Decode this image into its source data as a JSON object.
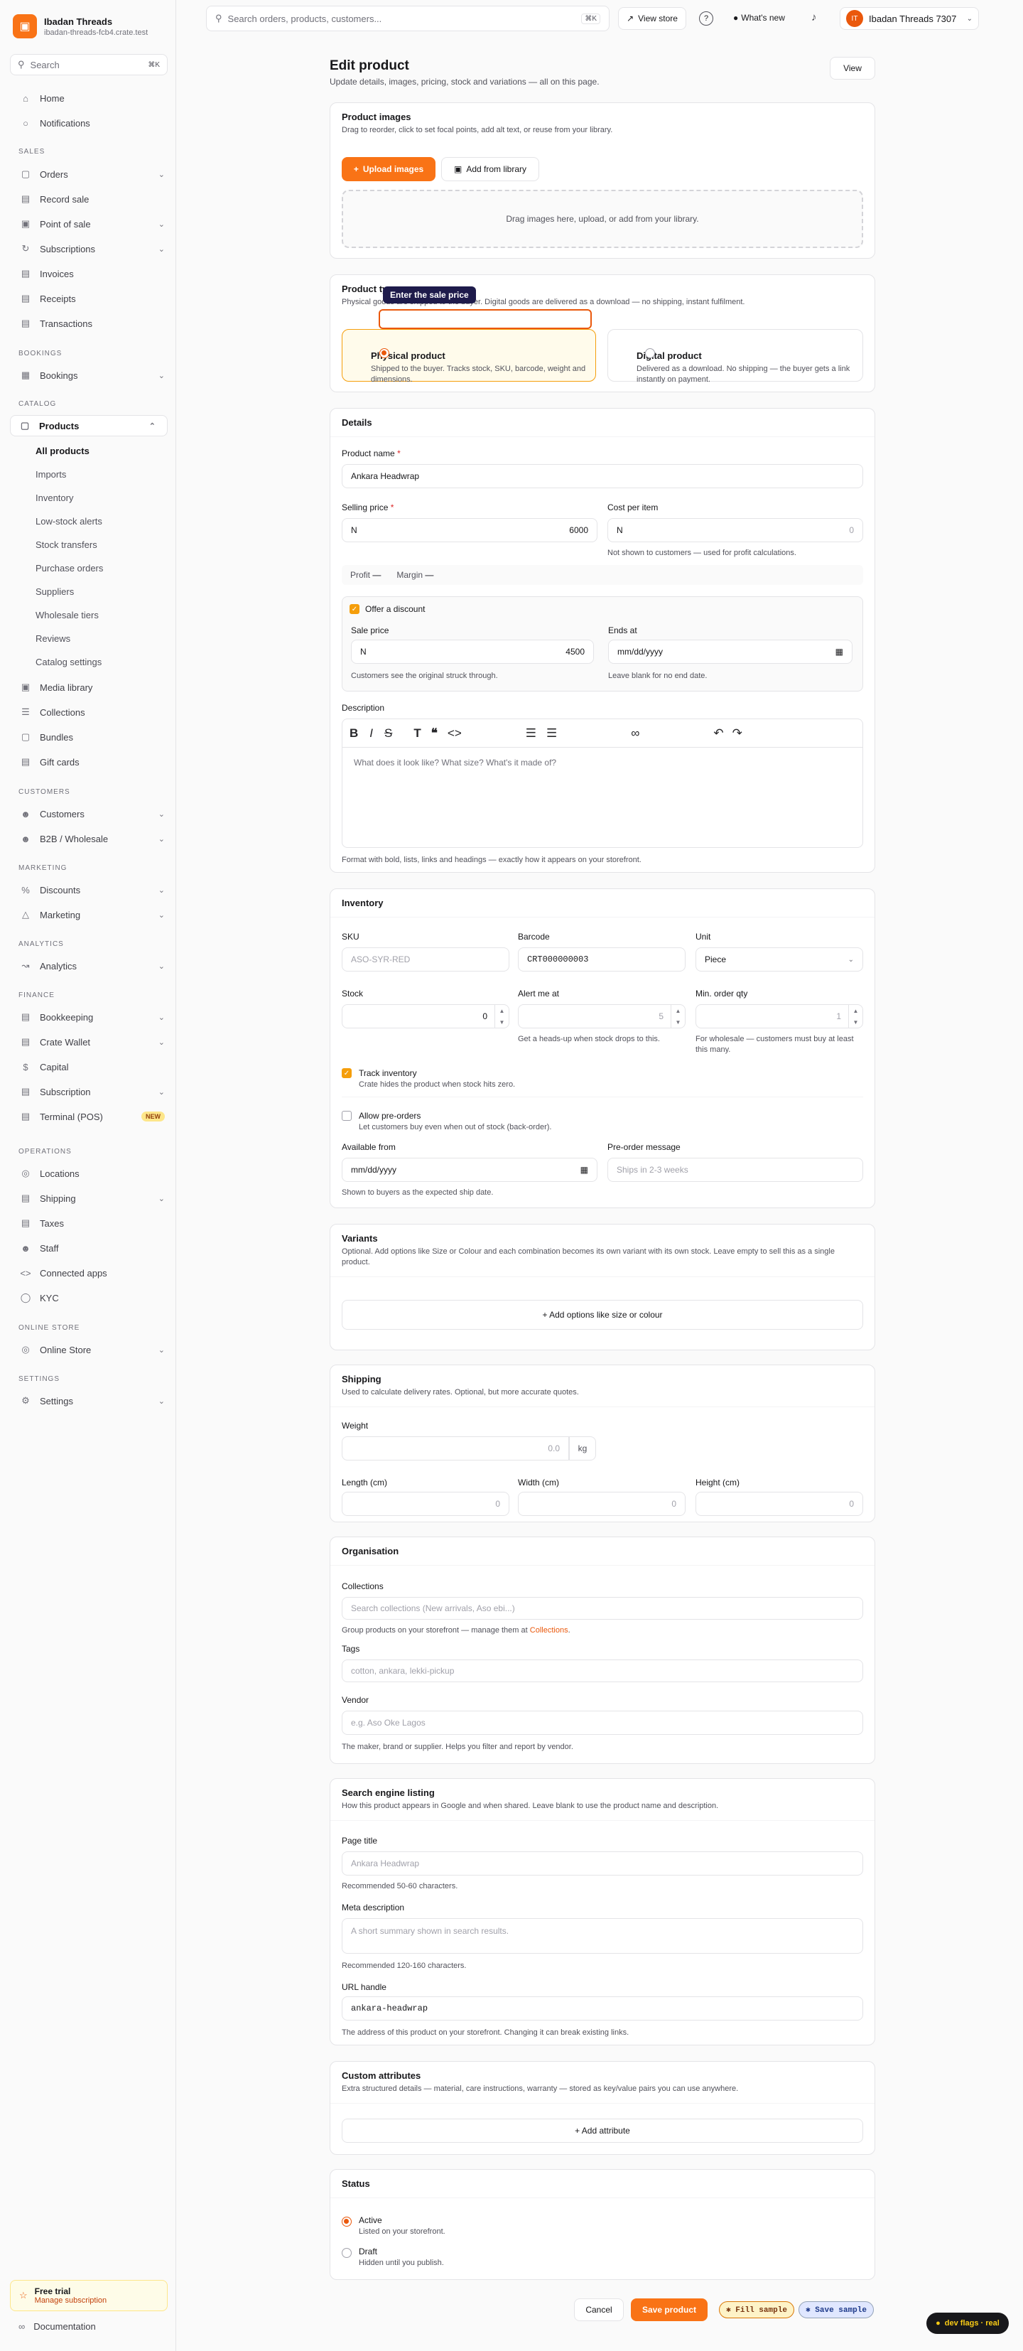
{
  "store": {
    "name": "Ibadan Threads",
    "domain": "ibadan-threads-fcb4.crate.test"
  },
  "sidebar": {
    "search_placeholder": "Search",
    "search_kbd": "⌘K",
    "top_items": [
      "Home",
      "Notifications"
    ],
    "sections": {
      "sales": "SALES",
      "bookings": "BOOKINGS",
      "catalog": "CATALOG",
      "customers": "CUSTOMERS",
      "marketing": "MARKETING",
      "analytics": "ANALYTICS",
      "finance": "FINANCE",
      "operations": "OPERATIONS",
      "online_store": "ONLINE STORE",
      "settings": "SETTINGS"
    },
    "sales_items": [
      "Orders",
      "Record sale",
      "Point of sale",
      "Subscriptions",
      "Invoices",
      "Receipts",
      "Transactions"
    ],
    "bookings_items": [
      "Bookings"
    ],
    "catalog_items": [
      "Products"
    ],
    "products_sub": [
      "All products",
      "Imports",
      "Inventory",
      "Low-stock alerts",
      "Stock transfers",
      "Purchase orders",
      "Suppliers",
      "Wholesale tiers",
      "Reviews",
      "Catalog settings"
    ],
    "catalog_more": [
      "Media library",
      "Collections",
      "Bundles",
      "Gift cards"
    ],
    "customers_items": [
      "Customers",
      "B2B / Wholesale"
    ],
    "marketing_items": [
      "Discounts",
      "Marketing"
    ],
    "analytics_items": [
      "Analytics"
    ],
    "finance_items": [
      "Bookkeeping",
      "Crate Wallet",
      "Capital",
      "Subscription",
      "Terminal (POS)"
    ],
    "new_badge": "NEW",
    "operations_items": [
      "Locations",
      "Shipping",
      "Taxes",
      "Staff",
      "Connected apps",
      "KYC"
    ],
    "online_items": [
      "Online Store"
    ],
    "settings_items": [
      "Settings"
    ],
    "trial_title": "Free trial",
    "trial_link": "Manage subscription",
    "documentation": "Documentation"
  },
  "topbar": {
    "search_placeholder": "Search orders, products, customers...",
    "kbd": "⌘K",
    "view_store": "View store",
    "whats_new": "What's new",
    "account_initials": "IT",
    "account_name": "Ibadan Threads 7307"
  },
  "page": {
    "title": "Edit product",
    "subtitle": "Update details, images, pricing, stock and variations — all on this page.",
    "view": "View"
  },
  "images": {
    "title": "Product images",
    "desc": "Drag to reorder, click to set focal points, add alt text, or reuse from your library.",
    "upload": "Upload images",
    "library": "Add from library",
    "drop": "Drag images here, upload, or add from your library."
  },
  "type": {
    "title": "Product type",
    "desc": "Physical goods are shipped to the buyer. Digital goods are delivered as a download — no shipping, instant fulfilment.",
    "tooltip": "Enter the sale price",
    "physical_title": "Physical product",
    "physical_desc": "Shipped to the buyer. Tracks stock, SKU, barcode, weight and dimensions.",
    "digital_title": "Digital product",
    "digital_desc": "Delivered as a download. No shipping — the buyer gets a link instantly on payment."
  },
  "details": {
    "title": "Details",
    "name_label": "Product name",
    "name_value": "Ankara Headwrap",
    "price_label": "Selling price",
    "currency": "N",
    "price_value": "6000",
    "cost_label": "Cost per item",
    "cost_placeholder": "0",
    "cost_help": "Not shown to customers — used for profit calculations.",
    "profit_label": "Profit",
    "profit_value": "—",
    "margin_label": "Margin",
    "margin_value": "—",
    "discount_label": "Offer a discount",
    "sale_label": "Sale price",
    "sale_value": "4500",
    "sale_help": "Customers see the original struck through.",
    "ends_label": "Ends at",
    "ends_value": "mm/dd/yyyy",
    "ends_help": "Leave blank for no end date.",
    "desc_label": "Description",
    "desc_placeholder": "What does it look like? What size? What's it made of?",
    "desc_help": "Format with bold, lists, links and headings — exactly how it appears on your storefront."
  },
  "inventory": {
    "title": "Inventory",
    "sku_label": "SKU",
    "sku_placeholder": "ASO-SYR-RED",
    "barcode_label": "Barcode",
    "barcode_value": "CRT000000003",
    "unit_label": "Unit",
    "unit_value": "Piece",
    "stock_label": "Stock",
    "stock_value": "0",
    "alert_label": "Alert me at",
    "alert_placeholder": "5",
    "alert_help": "Get a heads-up when stock drops to this.",
    "min_label": "Min. order qty",
    "min_placeholder": "1",
    "min_help": "For wholesale — customers must buy at least this many.",
    "track_label": "Track inventory",
    "track_help": "Crate hides the product when stock hits zero.",
    "preorder_label": "Allow pre-orders",
    "preorder_help": "Let customers buy even when out of stock (back-order).",
    "avail_label": "Available from",
    "avail_value": "mm/dd/yyyy",
    "avail_help": "Shown to buyers as the expected ship date.",
    "premsg_label": "Pre-order message",
    "premsg_placeholder": "Ships in 2-3 weeks"
  },
  "variants": {
    "title": "Variants",
    "desc": "Optional. Add options like Size or Colour and each combination becomes its own variant with its own stock. Leave empty to sell this as a single product.",
    "add": "+ Add options like size or colour"
  },
  "shipping": {
    "title": "Shipping",
    "desc": "Used to calculate delivery rates. Optional, but more accurate quotes.",
    "weight_label": "Weight",
    "weight_placeholder": "0.0",
    "weight_unit": "kg",
    "length_label": "Length (cm)",
    "width_label": "Width (cm)",
    "height_label": "Height (cm)",
    "dim_placeholder": "0"
  },
  "organisation": {
    "title": "Organisation",
    "collections_label": "Collections",
    "collections_placeholder": "Search collections (New arrivals, Aso ebi...)",
    "collections_help": "Group products on your storefront — manage them at",
    "collections_link": "Collections",
    "tags_label": "Tags",
    "tags_placeholder": "cotton, ankara, lekki-pickup",
    "vendor_label": "Vendor",
    "vendor_placeholder": "e.g. Aso Oke Lagos",
    "vendor_help": "The maker, brand or supplier. Helps you filter and report by vendor."
  },
  "seo": {
    "title": "Search engine listing",
    "desc": "How this product appears in Google and when shared. Leave blank to use the product name and description.",
    "page_title_label": "Page title",
    "page_title_placeholder": "Ankara Headwrap",
    "page_title_help": "Recommended 50-60 characters.",
    "meta_label": "Meta description",
    "meta_placeholder": "A short summary shown in search results.",
    "meta_help": "Recommended 120-160 characters.",
    "handle_label": "URL handle",
    "handle_value": "ankara-headwrap",
    "handle_help": "The address of this product on your storefront. Changing it can break existing links."
  },
  "custom": {
    "title": "Custom attributes",
    "desc": "Extra structured details — material, care instructions, warranty — stored as key/value pairs you can use anywhere.",
    "add": "+ Add attribute"
  },
  "status": {
    "title": "Status",
    "active_label": "Active",
    "active_help": "Listed on your storefront.",
    "draft_label": "Draft",
    "draft_help": "Hidden until you publish."
  },
  "footer": {
    "cancel": "Cancel",
    "save": "Save product",
    "fill": "✱ Fill sample",
    "save_sample": "✱ Save sample",
    "devflags": "dev flags · real"
  },
  "colors": {
    "accent": "#f97316",
    "accent_dark": "#ea580c",
    "checkbox": "#f59e0b"
  }
}
